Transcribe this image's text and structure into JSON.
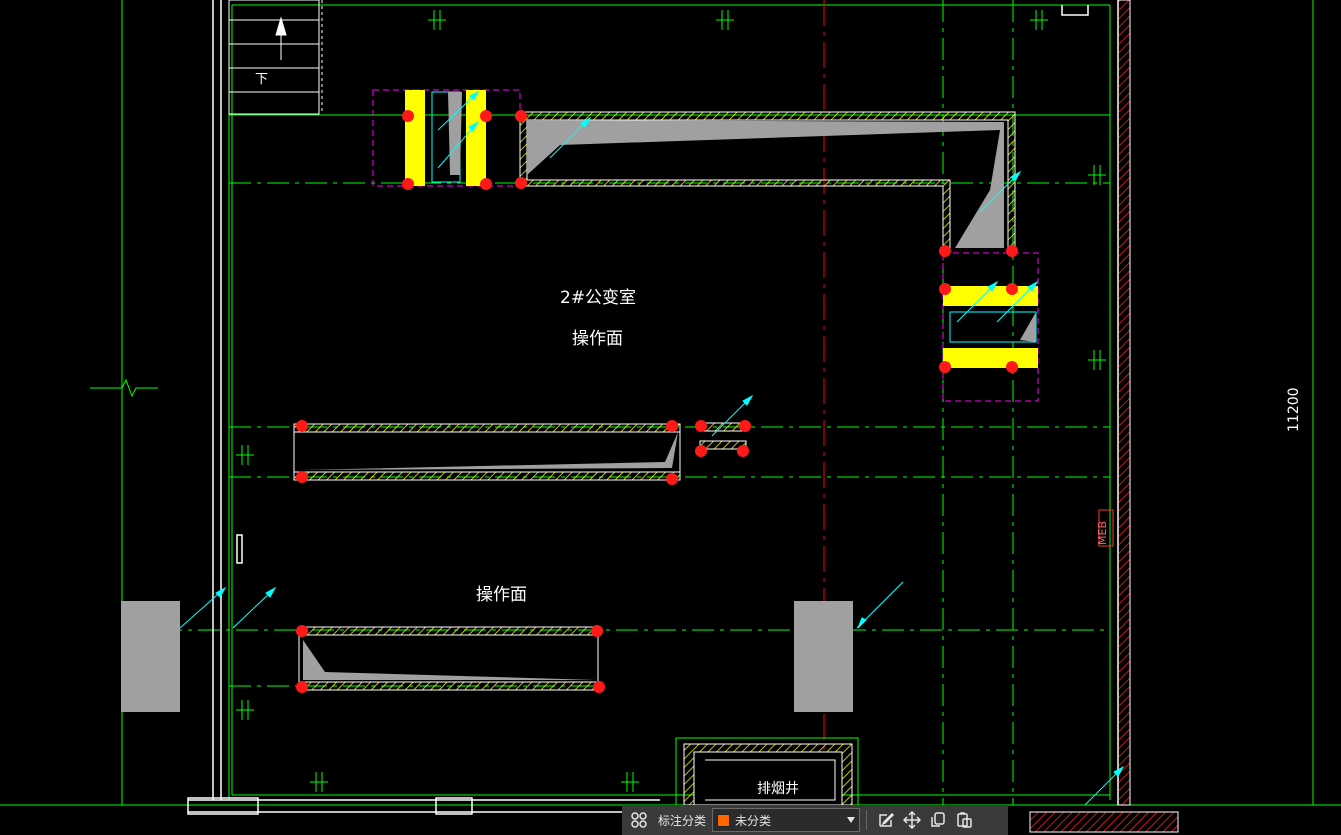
{
  "drawing": {
    "room_name": "2#公变室",
    "operating_face_1": "操作面",
    "operating_face_2": "操作面",
    "shaft_label": "排烟井",
    "stair_label": "下",
    "meb_label": "MEB",
    "dimension_value": "11200"
  },
  "colors": {
    "wall": "#ffffff",
    "axis_green": "#00ff00",
    "axis_red": "#ff0000",
    "hatch": "#ffff00",
    "grip": "#ff0000",
    "magenta": "#ff00ff",
    "cyan": "#00ffff",
    "gray_fill": "#a0a0a0"
  },
  "toolbar": {
    "label": "标注分类",
    "category_value": "未分类",
    "category_color": "#ff6600",
    "icons": [
      "grid-icon",
      "edit-icon",
      "move-icon",
      "copy-icon",
      "paste-icon"
    ]
  }
}
